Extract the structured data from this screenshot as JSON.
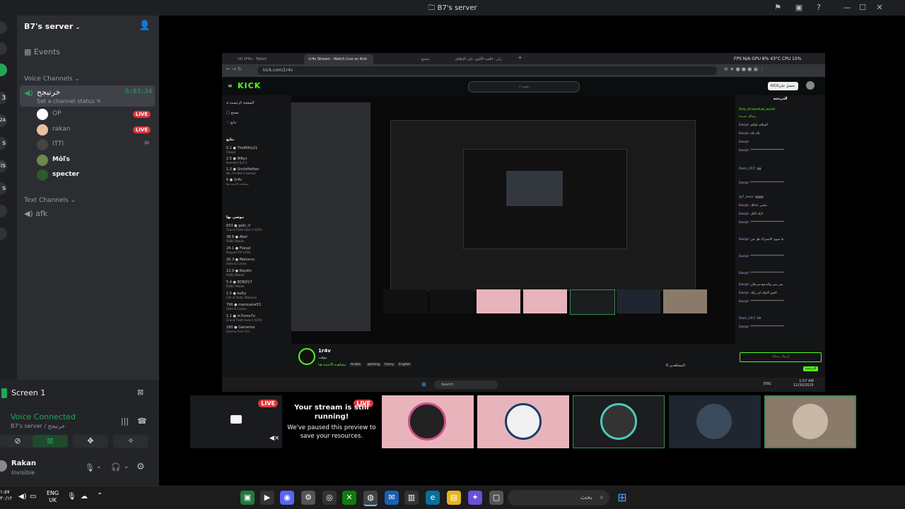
{
  "window": {
    "title": "B7's server"
  },
  "rail": {
    "items": [
      "",
      "",
      "",
      "3",
      "3ZA",
      "s",
      "is",
      "s",
      "",
      ""
    ]
  },
  "sidebar": {
    "server_name": "B7's server",
    "events_label": "Events",
    "voice_category": "Voice Channels",
    "voice_channel": {
      "name": "خرتيجح",
      "timer": "6:03:34",
      "status": "Set a channel status"
    },
    "members": [
      {
        "name": "OP",
        "live": "LIVE",
        "color": "#ffffff"
      },
      {
        "name": "rakan",
        "live": "LIVE",
        "color": "#e8c0a0"
      },
      {
        "name": "ITTI",
        "live": "",
        "color": "#444444"
      },
      {
        "name": "Mōľs",
        "live": "",
        "color": "#6a8a4a"
      },
      {
        "name": "specter",
        "live": "",
        "color": "#2d5a2d"
      }
    ],
    "text_category": "Text Channels",
    "text_channel": "afk"
  },
  "screen_panel": {
    "title": "Screen 1"
  },
  "voice_panel": {
    "status": "Voice Connected",
    "channel": "B7's server / خرتيجح"
  },
  "user_panel": {
    "name": "Rakan",
    "status": "Invisible"
  },
  "browser": {
    "tabs": [
      "(4) 1F4v - Twitch",
      "1r4v Stream - Watch Live on Kick",
      "",
      "مجمع",
      "رابر - اللعبة الأقوى على الإطلاق"
    ],
    "url": "kick.com/1r4v",
    "perf": "FPS N/A   GPU 8% 43°C   CPU 15%",
    "kick_logo": "KICK",
    "search_placeholder": "بحث",
    "login_button": "KICKنحصل على",
    "nav": [
      "الصفحة الرئيسية",
      "تصفح",
      "تتابع"
    ],
    "following_header": "تتابع",
    "following": [
      {
        "name": "TheWitty21",
        "sub": "Visage",
        "count": "5.1"
      },
      {
        "name": "W8yv",
        "sub": "Resident Evil 3",
        "count": "2.5"
      },
      {
        "name": "UncleHattan",
        "sub": "No, I'm Not A Human",
        "count": "1.2"
      },
      {
        "name": "1r4v",
        "sub": "مشاهدة الأجندة هنا",
        "count": "6"
      }
    ],
    "recommended_header": "موصى بها",
    "recommended": [
      {
        "name": "gabi_rr",
        "sub": "Grand Theft Auto V (GTA)",
        "count": "833"
      },
      {
        "name": "Abel",
        "sub": "PUBG Mobile",
        "count": "38.8"
      },
      {
        "name": "Flaisal",
        "sub": "Respect RP (GTA)",
        "count": "24.1"
      },
      {
        "name": "Mahorco",
        "sub": "Slots & Casino",
        "count": "20.3"
      },
      {
        "name": "Raydin",
        "sub": "PUBG Mobile",
        "count": "12.9"
      },
      {
        "name": "BOND17",
        "sub": "PUBG Mobile",
        "count": "5.4"
      },
      {
        "name": "bolty",
        "sub": "Call of Duty: Warzone",
        "count": "1.5"
      },
      {
        "name": "marouane53",
        "sub": "Slots & Casino",
        "count": "796"
      },
      {
        "name": "m7eme7o",
        "sub": "Grand Theft Auto V (GTA)",
        "count": "1.1"
      },
      {
        "name": "Gamerlss",
        "sub": "Garena Free Fire",
        "count": "180"
      }
    ],
    "chat_header": "الدردشة",
    "chat": [
      {
        "user": "0riw_streamhub_world",
        "msg": ""
      },
      {
        "user": "",
        "msg": "رسائل جديدة"
      },
      {
        "user": "ILoryz:",
        "msg": "السلام عليكم"
      },
      {
        "user": "ILoryz:",
        "msg": "بلاء بلاء"
      },
      {
        "user": "ILoryz:",
        "msg": ""
      },
      {
        "user": "ILoryz:",
        "msg": "*********************"
      },
      {
        "user": "Rami_CR7:",
        "msg": "gg"
      },
      {
        "user": "ILoryz:",
        "msg": "*********************"
      },
      {
        "user": "@7_easo:",
        "msg": "gggg"
      },
      {
        "user": "ILoryz:",
        "msg": "ماشي كذالك"
      },
      {
        "user": "ILoryz:",
        "msg": "لايك الكل"
      },
      {
        "user": "ILoryz:",
        "msg": "*********************"
      },
      {
        "user": "ILoryz:",
        "msg": "ما سوي الاشتراك هل في"
      },
      {
        "user": "ILoryz:",
        "msg": "*********************"
      },
      {
        "user": "ILoryz:",
        "msg": "*********************"
      },
      {
        "user": "ILoryz:",
        "msg": "بس بس ولاسمع سرطان"
      },
      {
        "user": "ILoryz:",
        "msg": "الحق الاولاد اي رايك"
      },
      {
        "user": "ILoryz:",
        "msg": "*********************"
      },
      {
        "user": "Rami_CR7:",
        "msg": "hh"
      },
      {
        "user": "ILoryz:",
        "msg": "*********************"
      }
    ],
    "chat_input": "إرسال رسالة",
    "chat_send": "الدردشة",
    "streamer": {
      "name": "1r4v",
      "sub": "مؤقت",
      "category": "مشاهدة الأجندة هنا",
      "tags": [
        "Arabic",
        "gaming",
        "funny",
        "English"
      ],
      "viewers": "المشاهدين 6"
    },
    "taskbar_time": "1:57 AM",
    "taskbar_date": "12/30/2025",
    "taskbar_lang": "ENG",
    "taskbar_search": "Search"
  },
  "stream_tiles": {
    "paused_title": "Your stream is still running!",
    "paused_body": "We've paused this preview to save your resources.",
    "live": "LIVE",
    "colors": [
      "#e8b4bc",
      "#e8b4bc",
      "#1b1d1e",
      "#1f2630",
      "#8a7a6a"
    ]
  },
  "taskbar": {
    "time": "١:٥٧",
    "date": "٣٠/١٢",
    "lang": "ENG",
    "region": "UK",
    "search_placeholder": "بحث"
  }
}
